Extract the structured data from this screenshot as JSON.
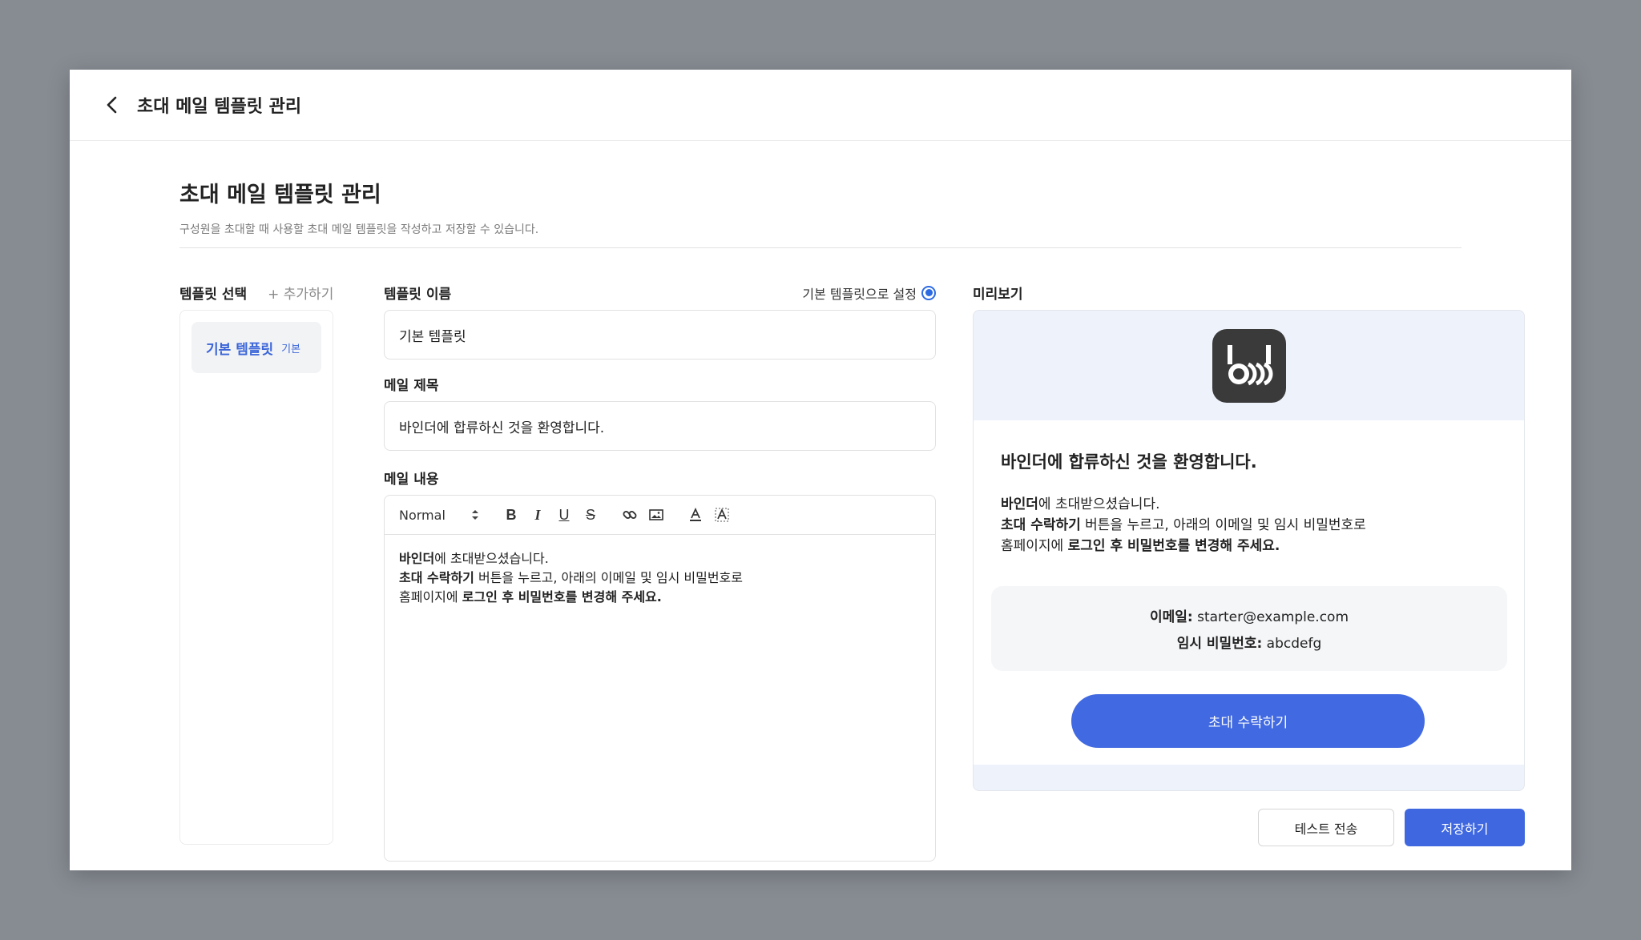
{
  "topbar": {
    "title": "초대 메일 템플릿 관리"
  },
  "header": {
    "title": "초대 메일 템플릿 관리",
    "description": "구성원을 초대할 때 사용할 초대 메일 템플릿을 작성하고 저장할 수 있습니다."
  },
  "templates": {
    "label": "템플릿 선택",
    "add_label": "+ 추가하기",
    "items": [
      {
        "name": "기본 템플릿",
        "badge": "기본"
      }
    ]
  },
  "form": {
    "name_label": "템플릿 이름",
    "default_label": "기본 템플릿으로 설정",
    "default_checked": true,
    "name_value": "기본 템플릿",
    "subject_label": "메일 제목",
    "subject_value": "바인더에 합류하신 것을 환영합니다.",
    "content_label": "메일 내용",
    "format_option": "Normal",
    "content": {
      "line1_bold": "바인더",
      "line1_rest": "에 초대받으셨습니다.",
      "line2_bold": "초대 수락하기",
      "line2_rest": " 버튼을 누르고, 아래의 이메일 및 임시 비밀번호로",
      "line3_start": "홈페이지에 ",
      "line3_bold": "로그인 후 비밀번호를 변경해 주세요."
    }
  },
  "preview": {
    "label": "미리보기",
    "title": "바인더에 합류하신 것을 환영합니다.",
    "email_label": "이메일:",
    "email_value": " starter@example.com",
    "password_label": "임시 비밀번호:",
    "password_value": " abcdefg",
    "accept_button": "초대 수락하기"
  },
  "actions": {
    "test_send": "테스트 전송",
    "save": "저장하기"
  },
  "colors": {
    "accent": "#4169e1",
    "preview_bg": "#eef2fb",
    "link": "#3b66d9"
  },
  "icons": [
    "chevron-left-icon",
    "bold-icon",
    "italic-icon",
    "underline-icon",
    "strike-icon",
    "link-icon",
    "image-icon",
    "text-color-icon",
    "clear-format-icon"
  ]
}
